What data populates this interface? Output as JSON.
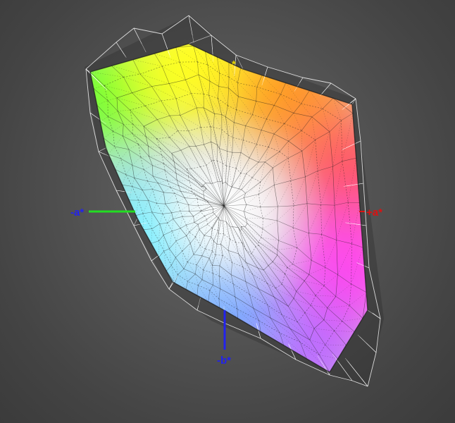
{
  "axes": {
    "neg_a": {
      "label": "-a*",
      "color": "#2222ee",
      "line_color": "#22dd22"
    },
    "pos_a": {
      "label": "+a*",
      "color": "#dd1111",
      "line_color": "#dd1111"
    },
    "neg_b": {
      "label": "-b*",
      "color": "#2222ee",
      "line_color": "#2222ee"
    },
    "pos_b": {
      "label": "*",
      "color": "#e6d200",
      "line_color": "#e6d200"
    }
  },
  "colors": {
    "background": "#555555",
    "wireframe_outer": "#ffffff",
    "wireframe_inner": "#1a1a1a",
    "gamut_green": "#66ff33",
    "gamut_yellow": "#ffff22",
    "gamut_orange": "#ff9922",
    "gamut_red": "#ff5566",
    "gamut_magenta": "#ff44ee",
    "gamut_violet": "#bb66ff",
    "gamut_blue": "#77aaff",
    "gamut_cyan": "#66eeff",
    "gamut_white": "#ffffff"
  }
}
